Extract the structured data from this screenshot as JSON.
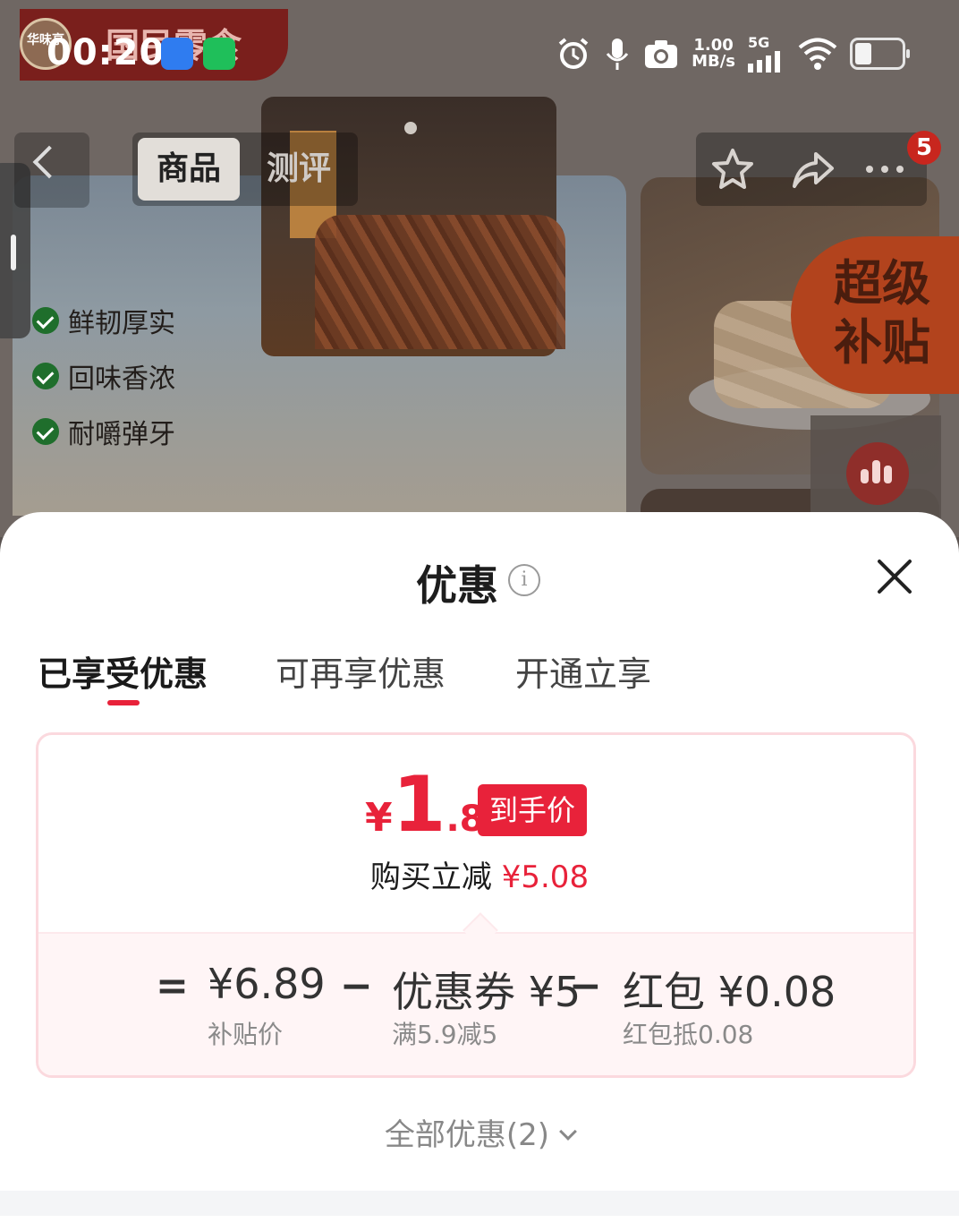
{
  "status_bar": {
    "time": "00:20",
    "net_speed": "1.00",
    "net_unit": "MB/s",
    "net_type": "5G"
  },
  "header": {
    "tabs": [
      "商品",
      "测评"
    ],
    "active_tab": "商品",
    "badge_count": "5"
  },
  "banner": {
    "brand_logo_text": "华味亨",
    "brand_slogan": "国民零食",
    "features": [
      "鲜韧厚实",
      "回味香浓",
      "耐嚼弹牙"
    ],
    "subsidy_tag": "超级补贴"
  },
  "sheet": {
    "title": "优惠",
    "tabs": [
      {
        "label": "已享受优惠",
        "active": true
      },
      {
        "label": "可再享优惠",
        "active": false
      },
      {
        "label": "开通立享",
        "active": false
      }
    ],
    "final_price": {
      "currency": "¥",
      "integer": "1",
      "decimal": ".81",
      "tag": "到手价"
    },
    "reduce": {
      "label": "购买立减",
      "amount": "¥5.08"
    },
    "breakdown": {
      "equals": "=",
      "minus": "−",
      "subsidy_price": "¥6.89",
      "subsidy_label": "补贴价",
      "coupon_value": "优惠券 ¥5",
      "coupon_label": "满5.9减5",
      "redpack_value": "红包 ¥0.08",
      "redpack_label": "红包抵0.08"
    },
    "all_offers": "全部优惠(2)"
  },
  "colors": {
    "accent_red": "#e8223a",
    "card_border": "#fbd9de",
    "subsidy_orange": "#b2431d"
  }
}
